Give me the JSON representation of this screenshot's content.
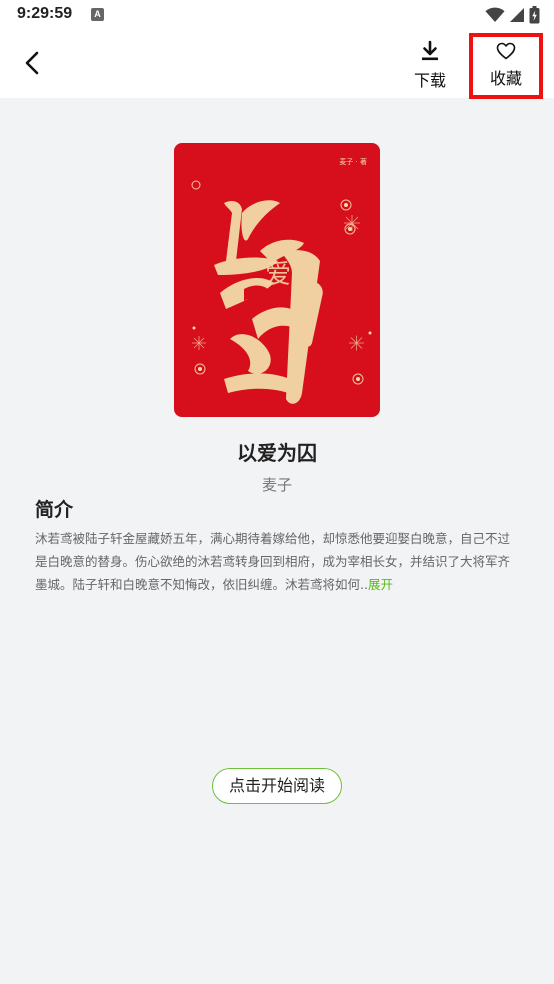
{
  "status_bar": {
    "time": "9:29:59",
    "app_icon_letter": "A",
    "icons": [
      "wifi-icon",
      "signal-icon",
      "battery-icon"
    ]
  },
  "top_bar": {
    "back_icon": "chevron-left-icon",
    "download_label": "下载",
    "download_icon": "download-icon",
    "favorite_label": "收藏",
    "favorite_icon": "heart-outline-icon",
    "highlight_color": "#ee1111"
  },
  "book": {
    "cover_brand": "麦子 · 著",
    "cover_art_text": "以爱为囚",
    "cover_color": "#d70f1d",
    "title": "以爱为囚",
    "author": "麦子"
  },
  "intro": {
    "heading": "简介",
    "text": "沐若鸢被陆子轩金屋藏娇五年，满心期待着嫁给他，却惊悉他要迎娶白晚意，自己不过是白晚意的替身。伤心欲绝的沐若鸢转身回到相府，成为宰相长女，并结识了大将军齐墨城。陆子轩和白晚意不知悔改，依旧纠缠。沐若鸢将如何..",
    "expand_label": "展开",
    "expand_color": "#55bb11"
  },
  "actions": {
    "start_reading": "点击开始阅读",
    "accent_color": "#6cc13a"
  }
}
